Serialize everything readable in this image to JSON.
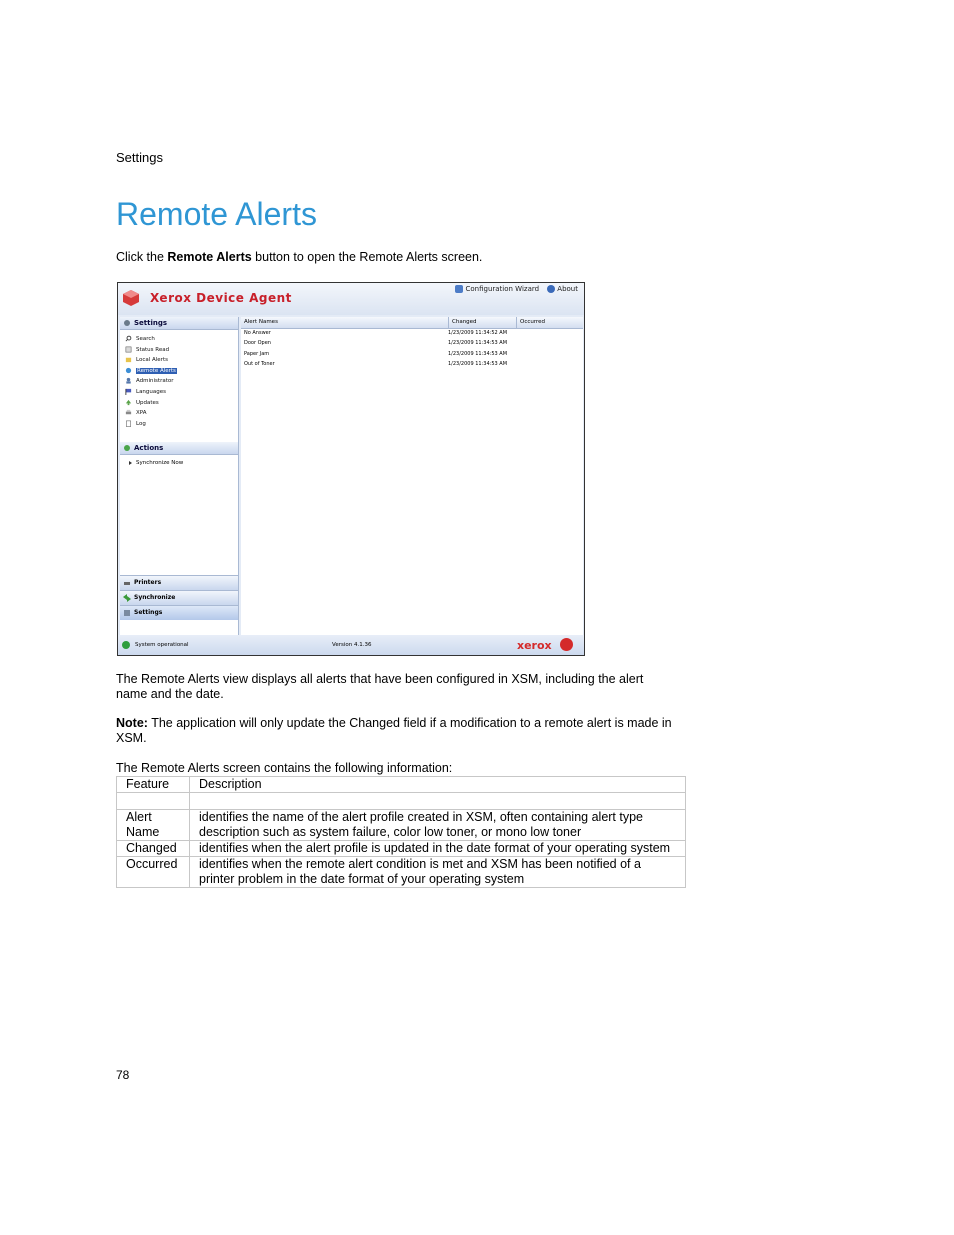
{
  "header": {
    "section": "Settings"
  },
  "title": "Remote Alerts",
  "intro": {
    "before": "Click the ",
    "bold": "Remote Alerts",
    "after": " button to open the Remote Alerts screen."
  },
  "screenshot": {
    "app_title": "Xerox Device Agent",
    "top_links": {
      "config": "Configuration Wizard",
      "about": "About"
    },
    "settings_panel": "Settings",
    "nav_items": [
      "Search",
      "Status Read",
      "Local Alerts",
      "Remote Alerts",
      "Administrator",
      "Languages",
      "Updates",
      "XPA",
      "Log"
    ],
    "actions_panel": "Actions",
    "action_item": "Synchronize Now",
    "bottom_tabs": [
      "Printers",
      "Synchronize",
      "Settings"
    ],
    "columns": [
      "Alert Names",
      "Changed",
      "Occurred"
    ],
    "rows": [
      {
        "name": "No Answer",
        "changed": "1/23/2009 11:34:52 AM"
      },
      {
        "name": "Door Open",
        "changed": "1/23/2009 11:34:53 AM"
      },
      {
        "name": "Paper Jam",
        "changed": "1/23/2009 11:34:53 AM"
      },
      {
        "name": "Out of Toner",
        "changed": "1/23/2009 11:34:53 AM"
      }
    ],
    "status": "System operational",
    "version": "Version 4.1.36",
    "brand": "xerox",
    "accent": "#2f96d4",
    "brand_red": "#c8202a"
  },
  "para1": "The Remote Alerts view displays all alerts that have been configured in XSM, including the alert name and the date.",
  "note": {
    "label": "Note:",
    "text": " The application will only update the Changed field if a modification to a remote alert is made in XSM."
  },
  "table_intro": "The Remote Alerts screen contains the following information:",
  "table": {
    "headers": [
      "Feature",
      "Description"
    ],
    "rows": [
      {
        "feature": "",
        "desc": ""
      },
      {
        "feature": "Alert Name",
        "desc": "identifies the name of the alert profile created in XSM, often containing alert type description such as system failure, color low toner, or mono low toner"
      },
      {
        "feature": "Changed",
        "desc": "identifies when the alert profile is updated in the date format of your operating system"
      },
      {
        "feature": "Occurred",
        "desc": "identifies when the remote alert condition is met and XSM has been notified of a printer problem in the date format of your operating system"
      }
    ]
  },
  "page_number": "78"
}
